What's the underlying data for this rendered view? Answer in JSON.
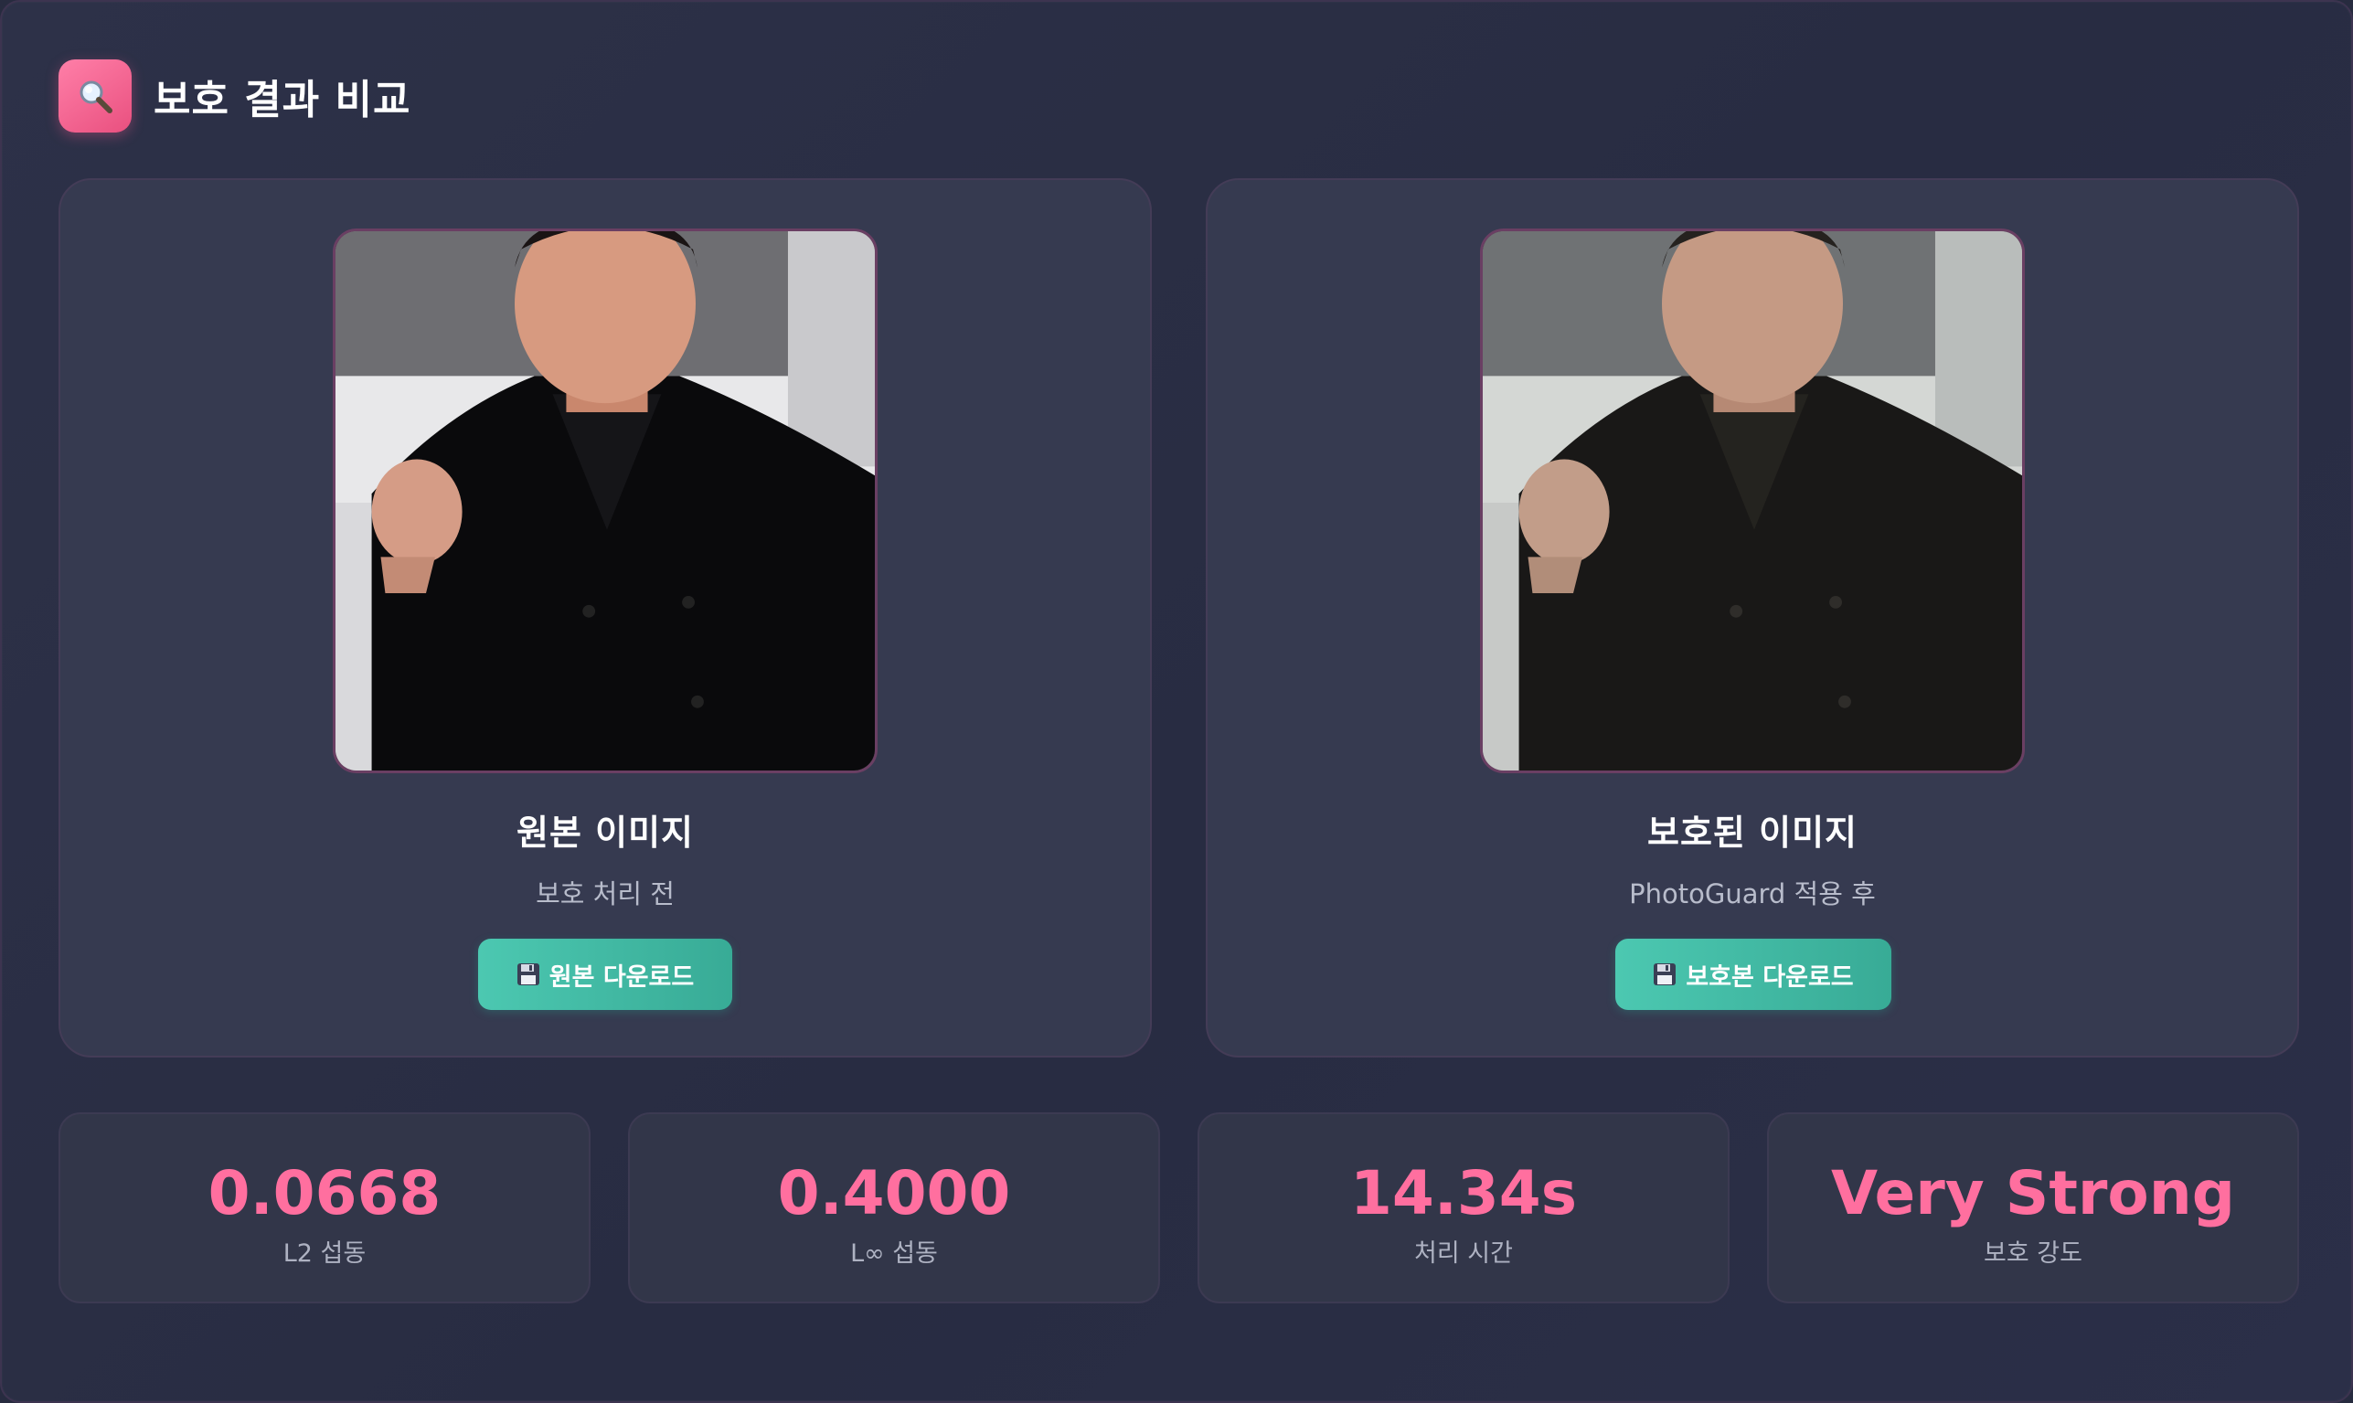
{
  "header": {
    "title": "보호 결과 비교",
    "icon": "search-icon"
  },
  "original": {
    "title": "원본 이미지",
    "subtitle": "보호 처리 전",
    "download_label": "원본 다운로드",
    "download_icon": "floppy-disk-icon"
  },
  "protected": {
    "title": "보호된 이미지",
    "subtitle": "PhotoGuard 적용 후",
    "download_label": "보호본 다운로드",
    "download_icon": "floppy-disk-icon"
  },
  "stats": [
    {
      "value": "0.0668",
      "label": "L2 섭동"
    },
    {
      "value": "0.4000",
      "label": "L∞ 섭동"
    },
    {
      "value": "14.34s",
      "label": "처리 시간"
    },
    {
      "value": "Very Strong",
      "label": "보호 강도"
    }
  ],
  "colors": {
    "accent_pink": "#ff6f9f",
    "button_teal": "#44bea8",
    "background": "#272b3f",
    "card": "#363a50"
  }
}
